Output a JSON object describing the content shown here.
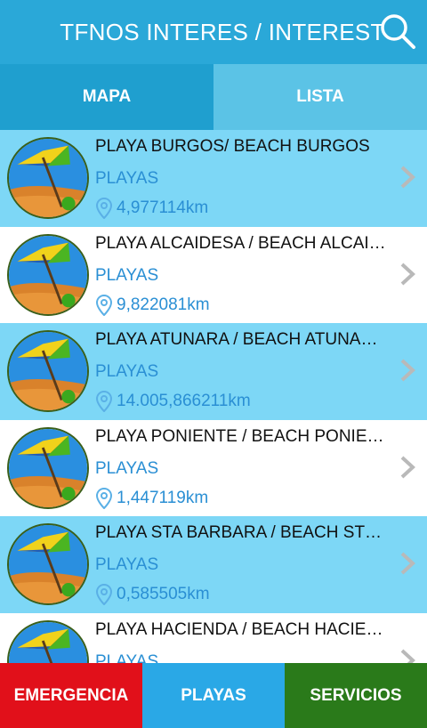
{
  "header": {
    "title": "TFNOS INTERES / INTEREST",
    "search_icon": "search-icon"
  },
  "tabs": [
    {
      "label": "MAPA",
      "active": true
    },
    {
      "label": "LISTA",
      "active": false
    }
  ],
  "list": {
    "items": [
      {
        "title": "PLAYA BURGOS/ BEACH BURGOS",
        "category": "PLAYAS",
        "distance": "4,977114km"
      },
      {
        "title": "PLAYA ALCAIDESA / BEACH ALCAI…",
        "category": "PLAYAS",
        "distance": "9,822081km"
      },
      {
        "title": "PLAYA ATUNARA / BEACH ATUNA…",
        "category": "PLAYAS",
        "distance": "14.005,866211km"
      },
      {
        "title": "PLAYA PONIENTE / BEACH PONIE…",
        "category": "PLAYAS",
        "distance": "1,447119km"
      },
      {
        "title": "PLAYA STA BARBARA / BEACH ST…",
        "category": "PLAYAS",
        "distance": "0,585505km"
      },
      {
        "title": "PLAYA HACIENDA / BEACH HACIE…",
        "category": "PLAYAS",
        "distance": ""
      }
    ]
  },
  "bottom_nav": {
    "emergencia": "EMERGENCIA",
    "playas": "PLAYAS",
    "servicios": "SERVICIOS"
  },
  "colors": {
    "header": "#2aa8d8",
    "row_highlight": "#7dd7f6",
    "emergencia": "#e1101a",
    "playas": "#2aa8e6",
    "servicios": "#2a7a1a"
  }
}
